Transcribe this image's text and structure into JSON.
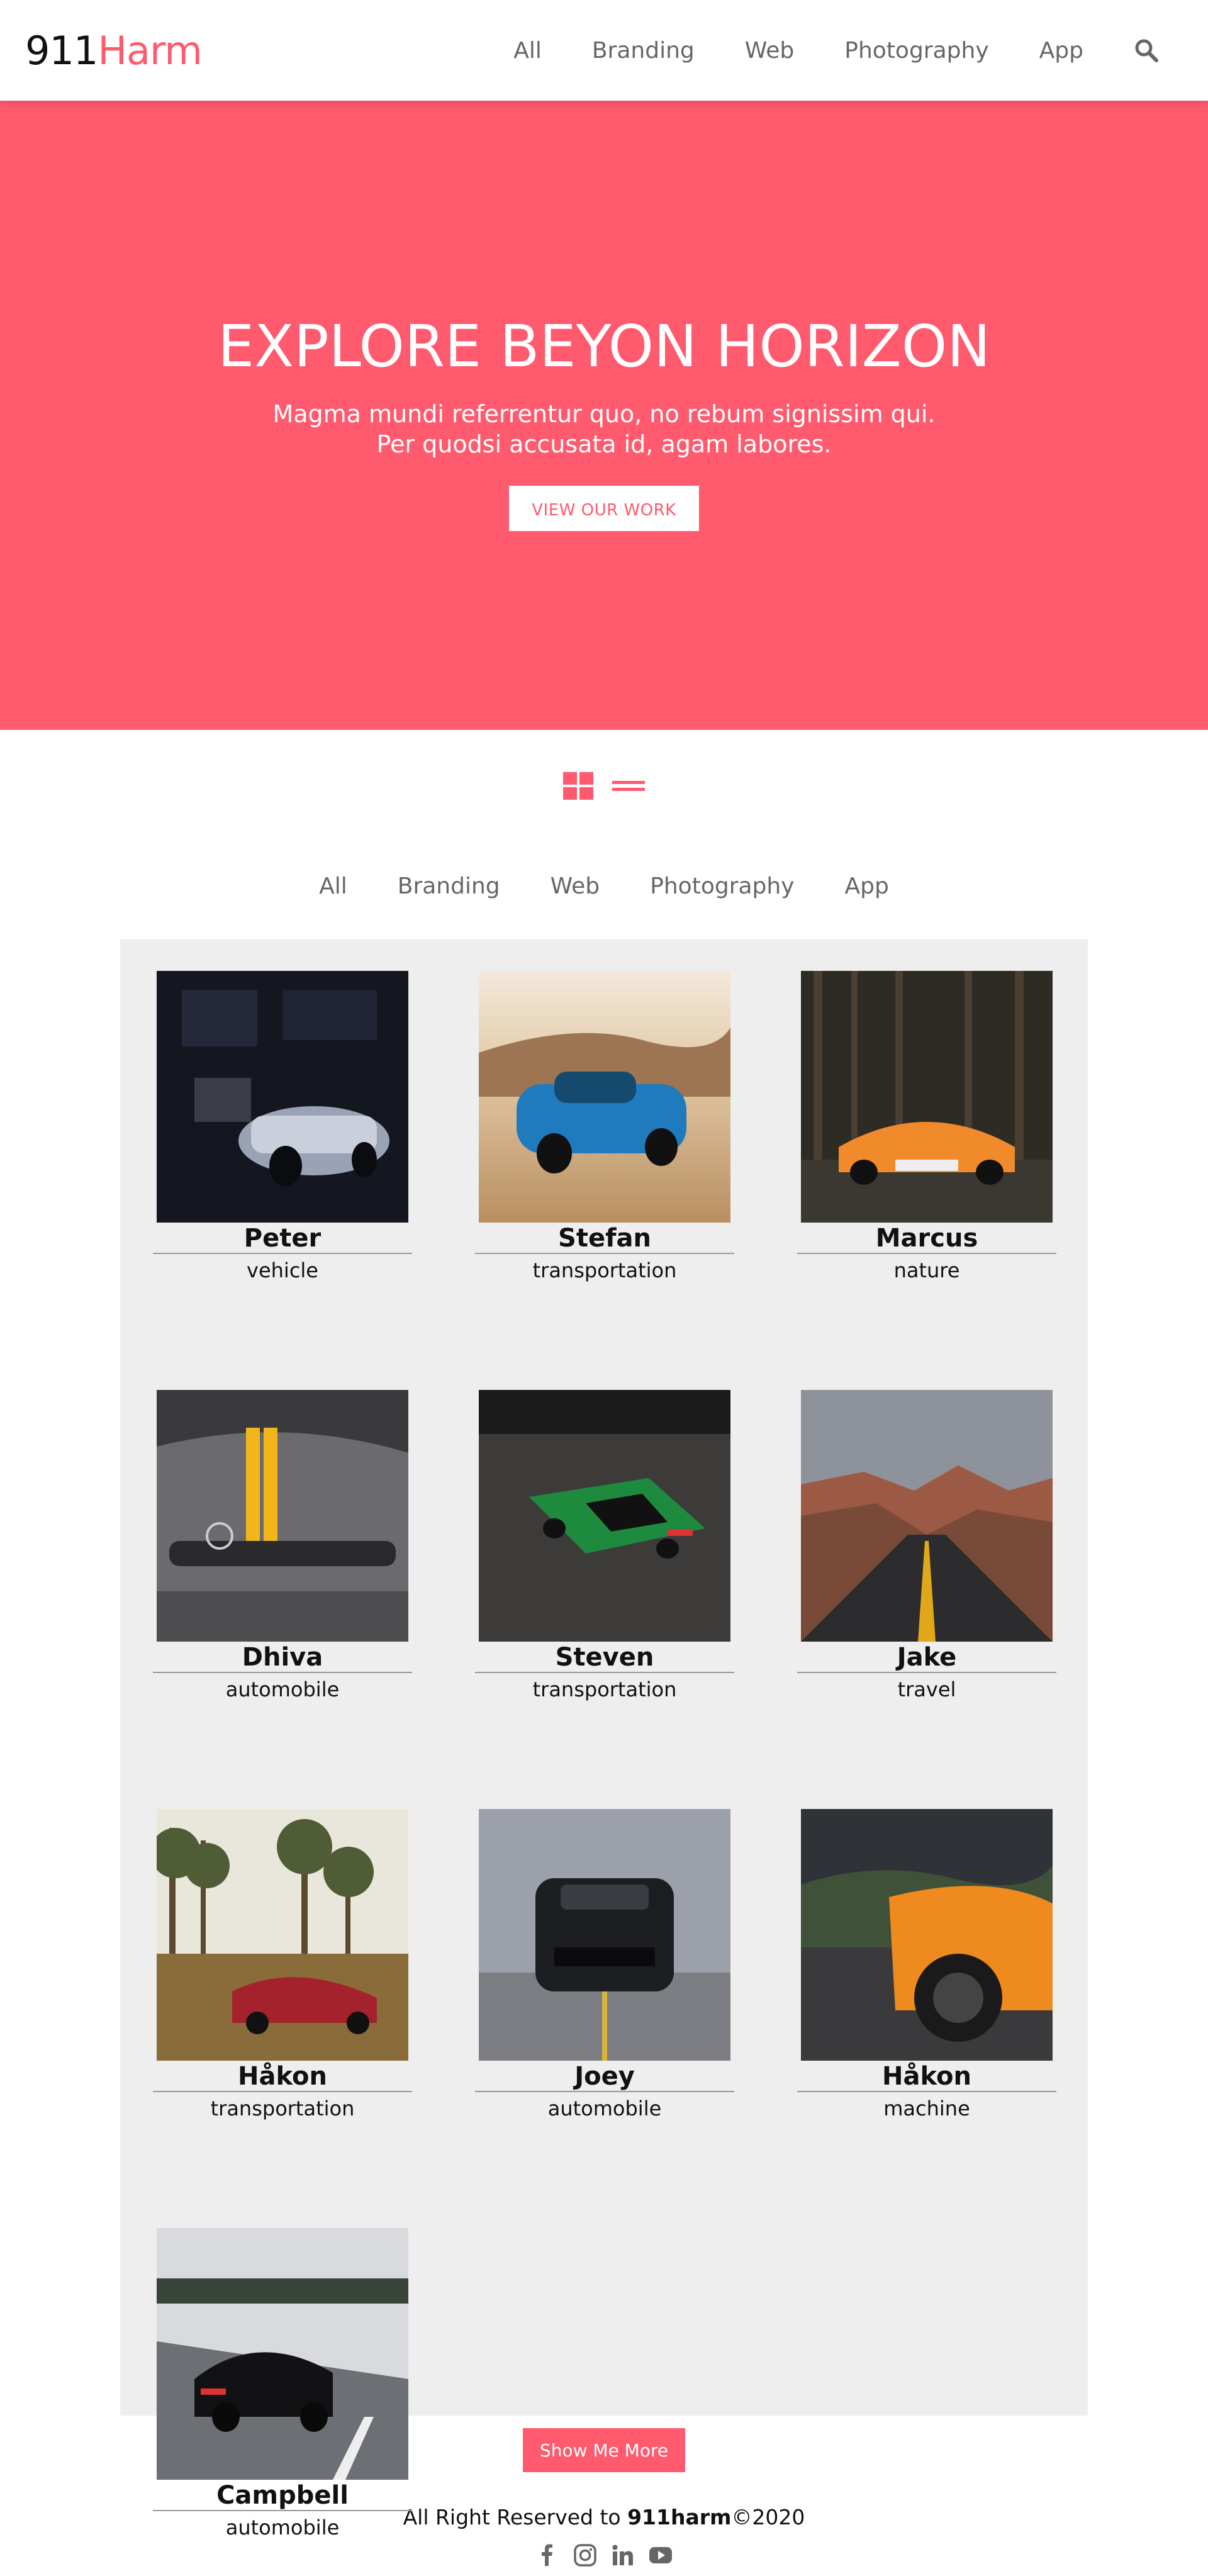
{
  "header": {
    "logo_part1": "911",
    "logo_part2": "Harm",
    "nav": [
      "All",
      "Branding",
      "Web",
      "Photography",
      "App"
    ],
    "search_icon": "search-icon"
  },
  "hero": {
    "title": "EXPLORE BEYON HORIZON",
    "subtitle_line1": "Magma mundi referrentur quo, no rebum signissim qui.",
    "subtitle_line2": "Per quodsi accusata id, agam labores.",
    "cta": "VIEW OUR WORK"
  },
  "view_toggle": {
    "grid_icon": "grid-view-icon",
    "list_icon": "list-view-icon"
  },
  "filters": [
    "All",
    "Branding",
    "Web",
    "Photography",
    "App"
  ],
  "gallery": [
    {
      "name": "Peter",
      "category": "vehicle"
    },
    {
      "name": "Stefan",
      "category": "transportation"
    },
    {
      "name": "Marcus",
      "category": "nature"
    },
    {
      "name": "Dhiva",
      "category": "automobile"
    },
    {
      "name": "Steven",
      "category": "transportation"
    },
    {
      "name": "Jake",
      "category": "travel"
    },
    {
      "name": "Håkon",
      "category": "transportation"
    },
    {
      "name": "Joey",
      "category": "automobile"
    },
    {
      "name": "Håkon",
      "category": "machine"
    },
    {
      "name": "Campbell",
      "category": "automobile"
    }
  ],
  "show_more": "Show Me More",
  "footer": {
    "copy_prefix": "All Right Reserved to ",
    "copy_brand": "911harm",
    "copy_suffix": "©2020",
    "socials": [
      "facebook-icon",
      "instagram-icon",
      "linkedin-icon",
      "youtube-icon"
    ]
  },
  "colors": {
    "accent": "#ff5a6e",
    "gallery_bg": "#eeeeee",
    "nav_text": "#666666"
  }
}
